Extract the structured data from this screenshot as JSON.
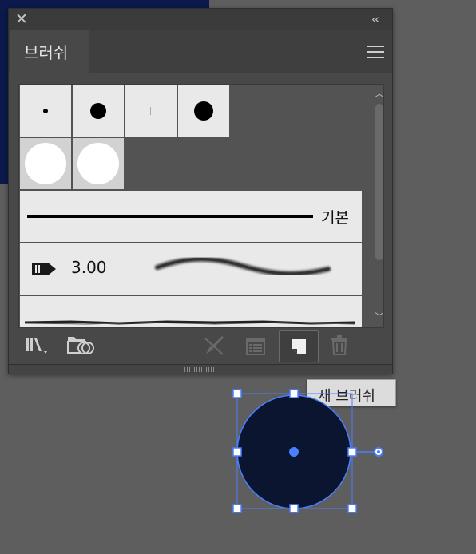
{
  "panel": {
    "tab_label": "브러쉬",
    "basic_brush_name": "기본",
    "calligraphic_size": "3.00"
  },
  "toolbar": {
    "items": [
      "brush-libraries-icon",
      "cc-libraries-icon",
      "remove-stroke-icon",
      "options-icon",
      "new-brush-icon",
      "delete-icon"
    ]
  },
  "tooltip": {
    "text": "새 브러쉬"
  },
  "colors": {
    "panel_bg": "#484848",
    "swatch_bg": "#e9e9e9",
    "artboard": "#0b1a4a",
    "selection": "#4a7fff",
    "shape_fill": "#0b1530"
  }
}
